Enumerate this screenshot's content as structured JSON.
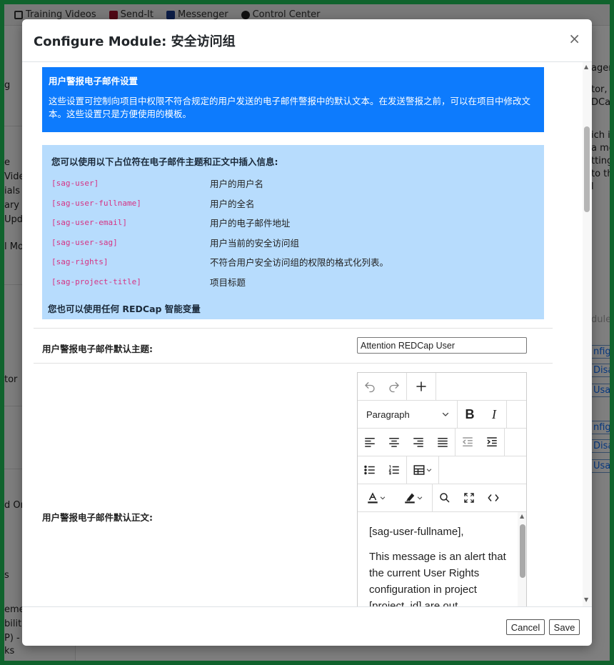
{
  "background": {
    "nav": [
      {
        "label": "Training Videos",
        "icon": "film-icon"
      },
      {
        "label": "Send-It",
        "icon": "envelope-icon"
      },
      {
        "label": "Messenger",
        "icon": "messenger-icon"
      },
      {
        "label": "Control Center",
        "icon": "gear-icon"
      }
    ],
    "left_fragments": [
      "g",
      "e",
      "Vide",
      "ials",
      "ary",
      "Upda",
      "l Mo",
      "tor",
      "d On",
      "s",
      "eme",
      "bilit",
      "P) - C",
      "ks"
    ],
    "right_fragments": [
      "ager",
      "tor,",
      "DCap",
      "ich i",
      "a mo",
      "tting",
      "to th",
      "l",
      "dule"
    ],
    "right_buttons": [
      "nfigu",
      "Disab",
      "Usa",
      "nfigu",
      "Disab",
      "Usa"
    ]
  },
  "modal": {
    "title": "Configure Module: 安全访问组",
    "close": "×",
    "notice": {
      "title": "用户警报电子邮件设置",
      "text": "这些设置可控制向项目中权限不符合规定的用户发送的电子邮件警报中的默认文本。在发送警报之前，可以在项目中修改文本。这些设置只是方便使用的模板。"
    },
    "placeholders": {
      "title": "您可以使用以下占位符在电子邮件主题和正文中插入信息:",
      "items": [
        {
          "code": "[sag-user]",
          "desc": "用户的用户名"
        },
        {
          "code": "[sag-user-fullname]",
          "desc": "用户的全名"
        },
        {
          "code": "[sag-user-email]",
          "desc": "用户的电子邮件地址"
        },
        {
          "code": "[sag-user-sag]",
          "desc": "用户当前的安全访问组"
        },
        {
          "code": "[sag-rights]",
          "desc": "不符合用户安全访问组的权限的格式化列表。"
        },
        {
          "code": "[sag-project-title]",
          "desc": "项目标题"
        }
      ],
      "footer": "您也可以使用任何 REDCap 智能变量"
    },
    "subject": {
      "label": "用户警报电子邮件默认主题:",
      "value": "Attention REDCap User"
    },
    "body": {
      "label": "用户警报电子邮件默认正文:",
      "format": "Paragraph",
      "paragraph1": "[sag-user-fullname],",
      "paragraph2": "This message is an alert that the current User Rights configuration in project [project_id] are out"
    },
    "buttons": {
      "cancel": "Cancel",
      "save": "Save"
    }
  }
}
